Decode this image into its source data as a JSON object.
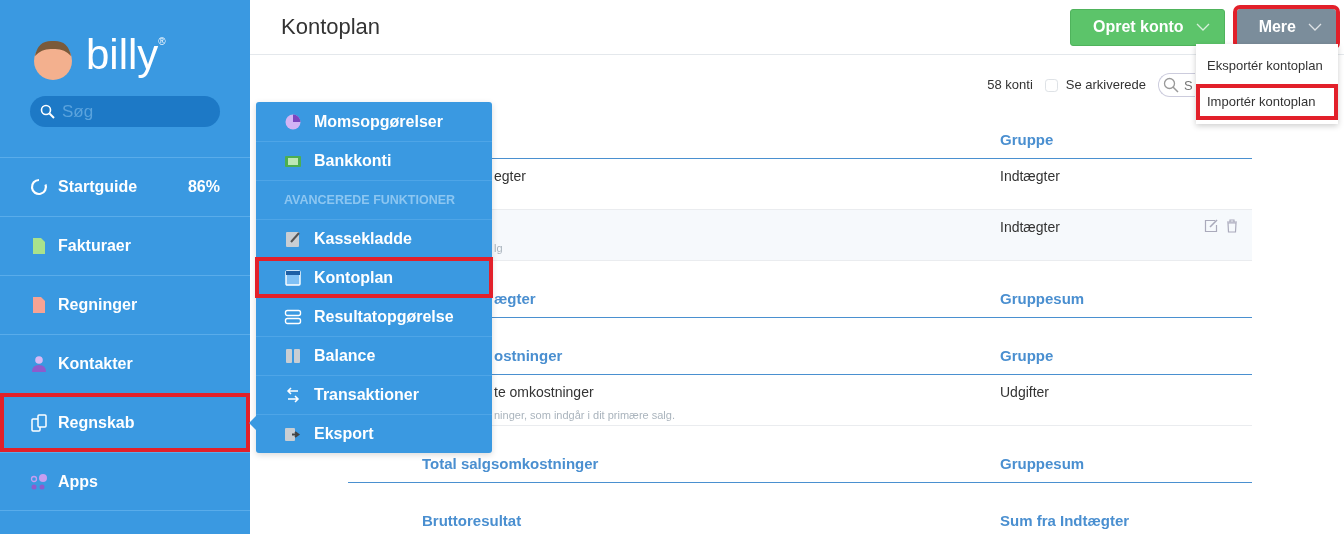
{
  "logo": {
    "text": "billy",
    "mark": "®"
  },
  "sidebar": {
    "search": {
      "placeholder": "Søg"
    },
    "items": [
      {
        "label": "Startguide",
        "badge": "86%",
        "highlighted": false
      },
      {
        "label": "Fakturaer",
        "highlighted": false
      },
      {
        "label": "Regninger",
        "highlighted": false
      },
      {
        "label": "Kontakter",
        "highlighted": false
      },
      {
        "label": "Regnskab",
        "highlighted": true
      },
      {
        "label": "Apps",
        "highlighted": false
      }
    ]
  },
  "flyout": {
    "items": [
      {
        "kind": "link",
        "label": "Momsopgørelser",
        "highlighted": false
      },
      {
        "kind": "link",
        "label": "Bankkonti",
        "highlighted": false
      },
      {
        "kind": "heading",
        "label": "AVANCEREDE FUNKTIONER"
      },
      {
        "kind": "link",
        "label": "Kassekladde",
        "highlighted": false
      },
      {
        "kind": "link",
        "label": "Kontoplan",
        "highlighted": true
      },
      {
        "kind": "link",
        "label": "Resultatopgørelse",
        "highlighted": false
      },
      {
        "kind": "link",
        "label": "Balance",
        "highlighted": false
      },
      {
        "kind": "link",
        "label": "Transaktioner",
        "highlighted": false
      },
      {
        "kind": "link",
        "label": "Eksport",
        "highlighted": false
      }
    ]
  },
  "page": {
    "title": "Kontoplan",
    "buttons": [
      {
        "label": "Opret konto",
        "kind": "primary",
        "highlighted": false
      },
      {
        "label": "Mere",
        "kind": "secondary",
        "highlighted": true
      }
    ],
    "more_menu": [
      {
        "label": "Eksportér kontoplan",
        "highlighted": false
      },
      {
        "label": "Importér kontoplan",
        "highlighted": true
      }
    ],
    "count": "58 konti",
    "archived": {
      "label": "Se arkiverede",
      "checked": false
    },
    "search": {
      "placeholder": "S"
    }
  },
  "table": {
    "rows": [
      {
        "kind": "heading",
        "group": "Gruppe"
      },
      {
        "kind": "account",
        "name": "egter",
        "partial": true,
        "group": "Indtægter",
        "hovered": false
      },
      {
        "kind": "account",
        "description": "lg",
        "partial": true,
        "group": "Indtægter",
        "hovered": true
      },
      {
        "kind": "total",
        "name": "ægter",
        "partial": true,
        "group": "Gruppesum"
      },
      {
        "kind": "heading",
        "name": "ostninger",
        "partial": true,
        "group": "Gruppe"
      },
      {
        "kind": "account",
        "name": "te omkostninger",
        "description": "ninger, som indgår i dit primære salg.",
        "partial": true,
        "group": "Udgifter",
        "hovered": false
      },
      {
        "kind": "total",
        "name": "Total salgsomkostninger",
        "partial": false,
        "group": "Gruppesum"
      },
      {
        "kind": "total",
        "name": "Bruttoresultat",
        "partial": false,
        "group": "Sum fra Indtægter"
      }
    ]
  }
}
